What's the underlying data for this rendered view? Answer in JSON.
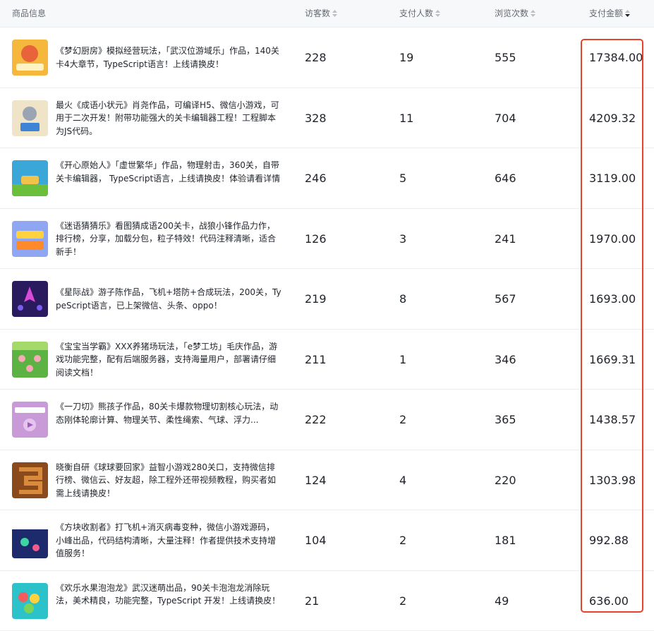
{
  "columns": {
    "product": "商品信息",
    "visitors": "访客数",
    "payers": "支付人数",
    "views": "浏览次数",
    "amount": "支付金额"
  },
  "rows": [
    {
      "desc": "《梦幻厨房》模拟经营玩法，「武汉位游域乐」作品，140关卡4大章节，TypeScript语言！上线请换皮！",
      "visitors": "228",
      "payers": "19",
      "views": "555",
      "amount": "17384.00",
      "thumb_color": "#f5b83d"
    },
    {
      "desc": "最火《成语小状元》肖尧作品，可编译H5、微信小游戏，可用于二次开发！附带功能强大的关卡编辑器工程！工程脚本为JS代码。",
      "visitors": "328",
      "payers": "11",
      "views": "704",
      "amount": "4209.32",
      "thumb_color": "#efe3c8"
    },
    {
      "desc": "《开心原始人》「虚世繁华」作品，物理射击，360关，自带关卡编辑器， TypeScript语言，上线请换皮！体验请看详情",
      "visitors": "246",
      "payers": "5",
      "views": "646",
      "amount": "3119.00",
      "thumb_color": "#3aa7d8"
    },
    {
      "desc": "《迷语猜猜乐》看图猜成语200关卡，战狼小锋作品力作，排行榜，分享，加载分包，粒子特效！代码注释清晰，适合新手！",
      "visitors": "126",
      "payers": "3",
      "views": "241",
      "amount": "1970.00",
      "thumb_color": "#8fa6f2"
    },
    {
      "desc": "《星际战》游子陈作品，飞机+塔防+合成玩法，200关，TypeScript语言，已上架微信、头条、oppo！",
      "visitors": "219",
      "payers": "8",
      "views": "567",
      "amount": "1693.00",
      "thumb_color": "#2a1b5e"
    },
    {
      "desc": "《宝宝当学霸》XXX养猪场玩法，「e梦工坊」毛庆作品，游戏功能完整，配有后端服务器，支持海量用户，部署请仔细阅读文档！",
      "visitors": "211",
      "payers": "1",
      "views": "346",
      "amount": "1669.31",
      "thumb_color": "#5db244"
    },
    {
      "desc": "《一刀切》熊孩子作品，80关卡爆款物理切割核心玩法，动态刚体轮廓计算、物理关节、柔性绳索、气球、浮力...",
      "visitors": "222",
      "payers": "2",
      "views": "365",
      "amount": "1438.57",
      "thumb_color": "#c99ad8"
    },
    {
      "desc": "晓衡自研《球球要回家》益智小游戏280关口，支持微信排行榜、微信云、好友超，除工程外还带视频教程，购买者如需上线请换皮！",
      "visitors": "124",
      "payers": "4",
      "views": "220",
      "amount": "1303.98",
      "thumb_color": "#8a4a1c"
    },
    {
      "desc": "《方块收割者》打飞机+消灭病毒变种，微信小游戏源码，小峰出品，代码结构清晰，大量注释！作者提供技术支持增值服务！",
      "visitors": "104",
      "payers": "2",
      "views": "181",
      "amount": "992.88",
      "thumb_color": "#1d2a6b"
    },
    {
      "desc": "《欢乐水果泡泡龙》武汉迷萌出品，90关卡泡泡龙消除玩法，美术精良，功能完整，TypeScript 开发！上线请换皮！",
      "visitors": "21",
      "payers": "2",
      "views": "49",
      "amount": "636.00",
      "thumb_color": "#2bc3c9"
    }
  ]
}
